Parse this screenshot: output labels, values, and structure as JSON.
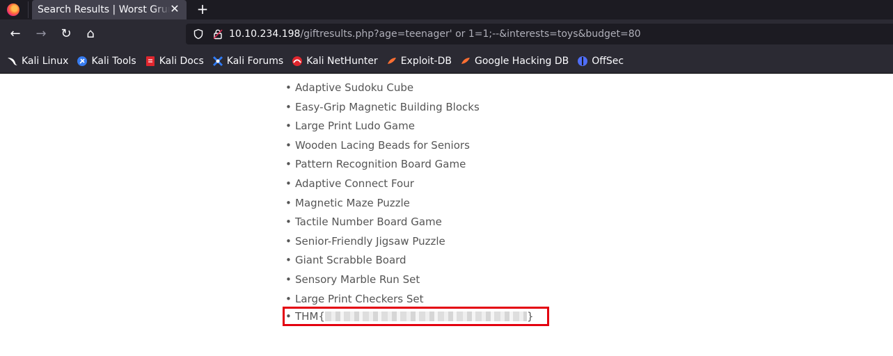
{
  "tab": {
    "title": "Search Results | Worst Grumpy",
    "close": "✕",
    "new_tab": "+"
  },
  "nav": {
    "back": "←",
    "forward": "→",
    "reload": "↻",
    "home": "⌂"
  },
  "url": {
    "host": "10.10.234.198",
    "path": "/giftresults.php?age=teenager' or 1=1;--&interests=toys&budget=80"
  },
  "bookmarks": [
    {
      "label": "Kali Linux",
      "icon": "kali-dragon-icon",
      "color": "#ffffff"
    },
    {
      "label": "Kali Tools",
      "icon": "kali-tools-icon",
      "color": "#367bf0"
    },
    {
      "label": "Kali Docs",
      "icon": "kali-docs-icon",
      "color": "#e0262e"
    },
    {
      "label": "Kali Forums",
      "icon": "kali-forums-icon",
      "color": "#2f7bf6"
    },
    {
      "label": "Kali NetHunter",
      "icon": "nethunter-icon",
      "color": "#e0262e"
    },
    {
      "label": "Exploit-DB",
      "icon": "exploit-db-icon",
      "color": "#ff6f32"
    },
    {
      "label": "Google Hacking DB",
      "icon": "ghdb-icon",
      "color": "#ff6f32"
    },
    {
      "label": "OffSec",
      "icon": "offsec-icon",
      "color": "#4f6ef7"
    }
  ],
  "gifts": [
    "Adaptive Sudoku Cube",
    "Easy-Grip Magnetic Building Blocks",
    "Large Print Ludo Game",
    "Wooden Lacing Beads for Seniors",
    "Pattern Recognition Board Game",
    "Adaptive Connect Four",
    "Magnetic Maze Puzzle",
    "Tactile Number Board Game",
    "Senior-Friendly Jigsaw Puzzle",
    "Giant Scrabble Board",
    "Sensory Marble Run Set",
    "Large Print Checkers Set"
  ],
  "flag": {
    "prefix": "THM{",
    "suffix": "}",
    "highlight_color": "#e3000f"
  }
}
